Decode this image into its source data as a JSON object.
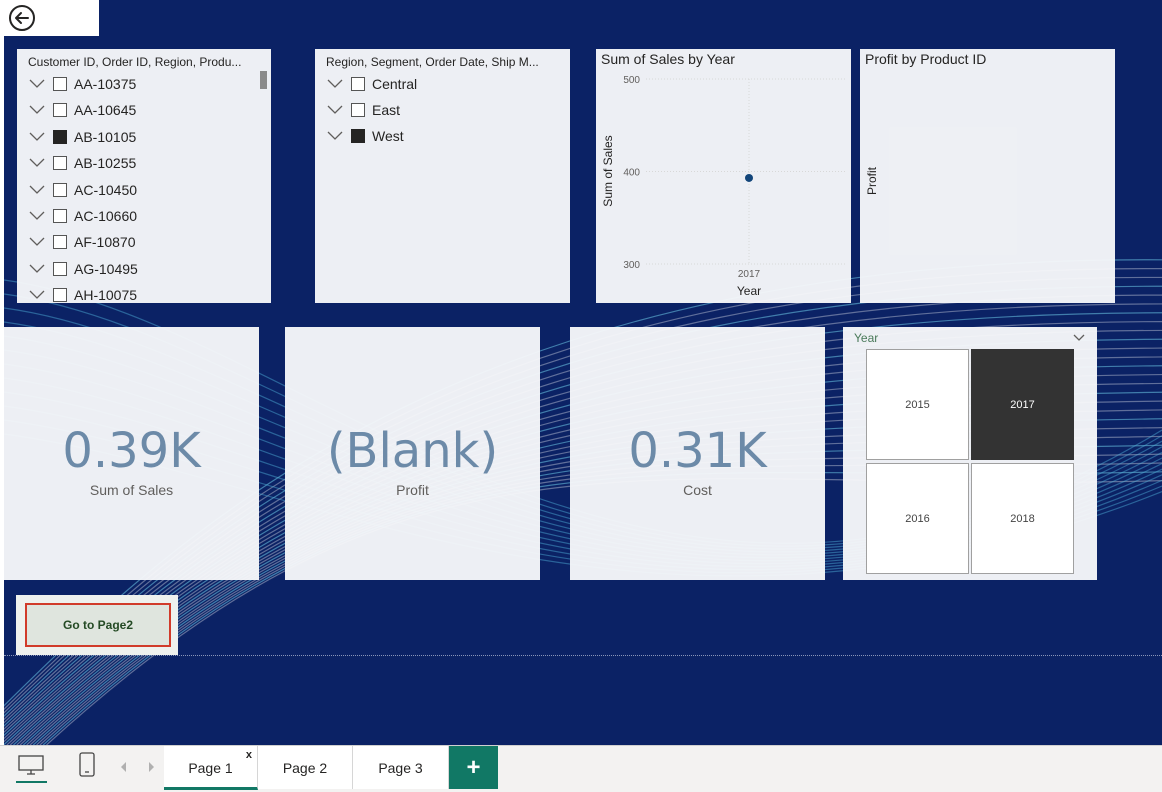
{
  "slicer_customers": {
    "header": "Customer ID, Order ID, Region, Produ...",
    "items": [
      {
        "label": "AA-10375",
        "checked": false
      },
      {
        "label": "AA-10645",
        "checked": false
      },
      {
        "label": "AB-10105",
        "checked": true
      },
      {
        "label": "AB-10255",
        "checked": false
      },
      {
        "label": "AC-10450",
        "checked": false
      },
      {
        "label": "AC-10660",
        "checked": false
      },
      {
        "label": "AF-10870",
        "checked": false
      },
      {
        "label": "AG-10495",
        "checked": false
      },
      {
        "label": "AH-10075",
        "checked": false
      }
    ]
  },
  "slicer_region": {
    "header": "Region, Segment, Order Date, Ship M...",
    "items": [
      {
        "label": "Central",
        "checked": false
      },
      {
        "label": "East",
        "checked": false
      },
      {
        "label": "West",
        "checked": true
      }
    ]
  },
  "sales_chart": {
    "title": "Sum of Sales by Year",
    "chart_data": {
      "type": "scatter",
      "title": "Sum of Sales by Year",
      "xlabel": "Year",
      "ylabel": "Sum of Sales",
      "x": [
        "2017"
      ],
      "y": [
        393
      ],
      "y_ticks": [
        300,
        400,
        500
      ],
      "ylim": [
        300,
        500
      ],
      "point_color": "#12457a"
    }
  },
  "profit_chart": {
    "title": "Profit by Product ID",
    "ylabel": "Profit"
  },
  "kpis": [
    {
      "value": "0.39K",
      "label": "Sum of Sales"
    },
    {
      "value": "(Blank)",
      "label": "Profit"
    },
    {
      "value": "0.31K",
      "label": "Cost"
    }
  ],
  "year_slicer": {
    "header": "Year",
    "tiles": [
      {
        "label": "2015",
        "selected": false
      },
      {
        "label": "2017",
        "selected": true
      },
      {
        "label": "2016",
        "selected": false
      },
      {
        "label": "2018",
        "selected": false
      }
    ]
  },
  "goto_button": "Go to Page2",
  "tabs": [
    {
      "label": "Page 1",
      "active": true,
      "close": "x"
    },
    {
      "label": "Page 2",
      "active": false
    },
    {
      "label": "Page 3",
      "active": false
    }
  ],
  "add_tab": "+",
  "colors": {
    "canvas": "#0b2265",
    "kpi": "#6c8aa8",
    "accent": "#117865",
    "button_border": "#d13b2a"
  },
  "icons": {
    "back": "back-arrow-icon",
    "desktop": "desktop-layout-icon",
    "mobile": "mobile-layout-icon"
  }
}
